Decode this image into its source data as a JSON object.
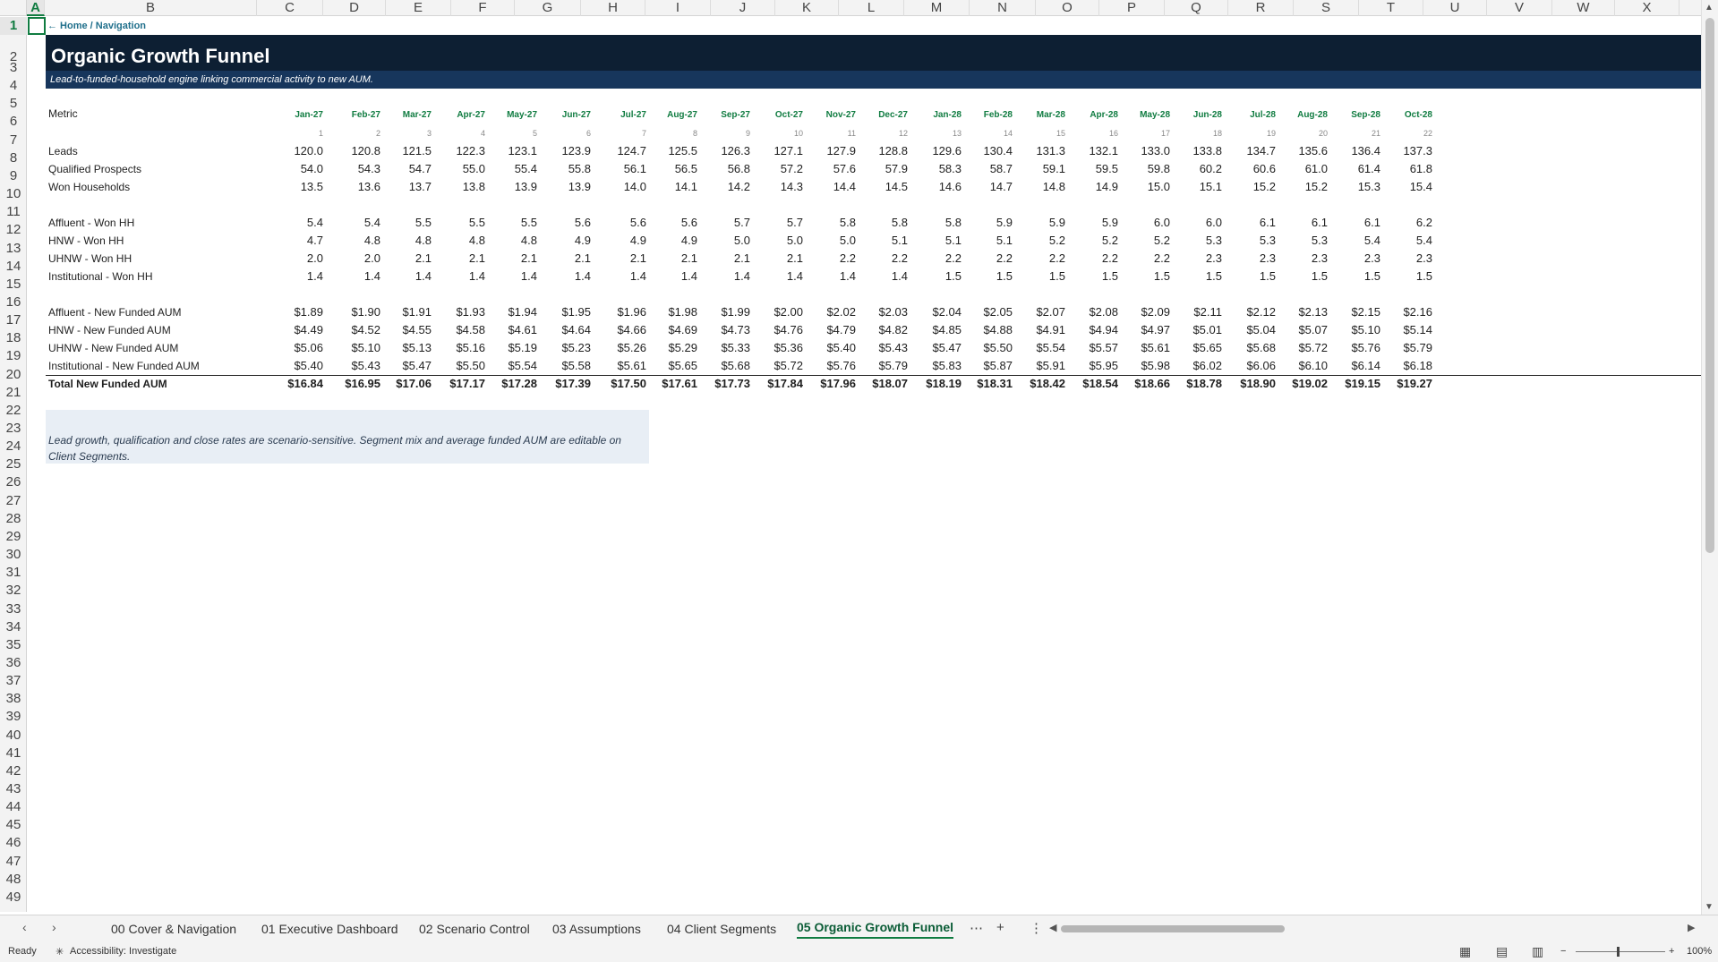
{
  "columns": [
    "A",
    "B",
    "C",
    "D",
    "E",
    "F",
    "G",
    "H",
    "I",
    "J",
    "K",
    "L",
    "M",
    "N",
    "O",
    "P",
    "Q",
    "R",
    "S",
    "T",
    "U",
    "V",
    "W",
    "X"
  ],
  "rows": [
    "1",
    "2",
    "3",
    "4",
    "5",
    "6",
    "7",
    "8",
    "9",
    "10",
    "11",
    "12",
    "13",
    "14",
    "15",
    "16",
    "17",
    "18",
    "19",
    "20",
    "21",
    "22",
    "23",
    "24",
    "25",
    "26",
    "27",
    "28",
    "29",
    "30",
    "31",
    "32",
    "33",
    "34",
    "35",
    "36",
    "37",
    "38",
    "39",
    "40",
    "41",
    "42",
    "43",
    "44",
    "45",
    "46",
    "47",
    "48",
    "49"
  ],
  "nav_link": "← Home / Navigation",
  "title": "Organic Growth Funnel",
  "subtitle": "Lead-to-funded-household engine linking commercial activity to new AUM.",
  "metric_header": "Metric",
  "months": [
    "Jan-27",
    "Feb-27",
    "Mar-27",
    "Apr-27",
    "May-27",
    "Jun-27",
    "Jul-27",
    "Aug-27",
    "Sep-27",
    "Oct-27",
    "Nov-27",
    "Dec-27",
    "Jan-28",
    "Feb-28",
    "Mar-28",
    "Apr-28",
    "May-28",
    "Jun-28",
    "Jul-28",
    "Aug-28",
    "Sep-28",
    "Oct-28"
  ],
  "period_index": [
    "1",
    "2",
    "3",
    "4",
    "5",
    "6",
    "7",
    "8",
    "9",
    "10",
    "11",
    "12",
    "13",
    "14",
    "15",
    "16",
    "17",
    "18",
    "19",
    "20",
    "21",
    "22"
  ],
  "table_rows": [
    {
      "label": "Leads",
      "values": [
        "120.0",
        "120.8",
        "121.5",
        "122.3",
        "123.1",
        "123.9",
        "124.7",
        "125.5",
        "126.3",
        "127.1",
        "127.9",
        "128.8",
        "129.6",
        "130.4",
        "131.3",
        "132.1",
        "133.0",
        "133.8",
        "134.7",
        "135.6",
        "136.4",
        "137.3"
      ]
    },
    {
      "label": "Qualified Prospects",
      "values": [
        "54.0",
        "54.3",
        "54.7",
        "55.0",
        "55.4",
        "55.8",
        "56.1",
        "56.5",
        "56.8",
        "57.2",
        "57.6",
        "57.9",
        "58.3",
        "58.7",
        "59.1",
        "59.5",
        "59.8",
        "60.2",
        "60.6",
        "61.0",
        "61.4",
        "61.8"
      ]
    },
    {
      "label": "Won Households",
      "values": [
        "13.5",
        "13.6",
        "13.7",
        "13.8",
        "13.9",
        "13.9",
        "14.0",
        "14.1",
        "14.2",
        "14.3",
        "14.4",
        "14.5",
        "14.6",
        "14.7",
        "14.8",
        "14.9",
        "15.0",
        "15.1",
        "15.2",
        "15.2",
        "15.3",
        "15.4"
      ]
    },
    {
      "label": "Affluent - Won HH",
      "values": [
        "5.4",
        "5.4",
        "5.5",
        "5.5",
        "5.5",
        "5.6",
        "5.6",
        "5.6",
        "5.7",
        "5.7",
        "5.8",
        "5.8",
        "5.8",
        "5.9",
        "5.9",
        "5.9",
        "6.0",
        "6.0",
        "6.1",
        "6.1",
        "6.1",
        "6.2"
      ]
    },
    {
      "label": "HNW - Won HH",
      "values": [
        "4.7",
        "4.8",
        "4.8",
        "4.8",
        "4.8",
        "4.9",
        "4.9",
        "4.9",
        "5.0",
        "5.0",
        "5.0",
        "5.1",
        "5.1",
        "5.1",
        "5.2",
        "5.2",
        "5.2",
        "5.3",
        "5.3",
        "5.3",
        "5.4",
        "5.4"
      ]
    },
    {
      "label": "UHNW - Won HH",
      "values": [
        "2.0",
        "2.0",
        "2.1",
        "2.1",
        "2.1",
        "2.1",
        "2.1",
        "2.1",
        "2.1",
        "2.1",
        "2.2",
        "2.2",
        "2.2",
        "2.2",
        "2.2",
        "2.2",
        "2.2",
        "2.3",
        "2.3",
        "2.3",
        "2.3",
        "2.3"
      ]
    },
    {
      "label": "Institutional - Won HH",
      "values": [
        "1.4",
        "1.4",
        "1.4",
        "1.4",
        "1.4",
        "1.4",
        "1.4",
        "1.4",
        "1.4",
        "1.4",
        "1.4",
        "1.4",
        "1.5",
        "1.5",
        "1.5",
        "1.5",
        "1.5",
        "1.5",
        "1.5",
        "1.5",
        "1.5",
        "1.5"
      ]
    },
    {
      "label": "Affluent - New Funded AUM",
      "values": [
        "$1.89",
        "$1.90",
        "$1.91",
        "$1.93",
        "$1.94",
        "$1.95",
        "$1.96",
        "$1.98",
        "$1.99",
        "$2.00",
        "$2.02",
        "$2.03",
        "$2.04",
        "$2.05",
        "$2.07",
        "$2.08",
        "$2.09",
        "$2.11",
        "$2.12",
        "$2.13",
        "$2.15",
        "$2.16"
      ]
    },
    {
      "label": "HNW - New Funded AUM",
      "values": [
        "$4.49",
        "$4.52",
        "$4.55",
        "$4.58",
        "$4.61",
        "$4.64",
        "$4.66",
        "$4.69",
        "$4.73",
        "$4.76",
        "$4.79",
        "$4.82",
        "$4.85",
        "$4.88",
        "$4.91",
        "$4.94",
        "$4.97",
        "$5.01",
        "$5.04",
        "$5.07",
        "$5.10",
        "$5.14"
      ]
    },
    {
      "label": "UHNW - New Funded AUM",
      "values": [
        "$5.06",
        "$5.10",
        "$5.13",
        "$5.16",
        "$5.19",
        "$5.23",
        "$5.26",
        "$5.29",
        "$5.33",
        "$5.36",
        "$5.40",
        "$5.43",
        "$5.47",
        "$5.50",
        "$5.54",
        "$5.57",
        "$5.61",
        "$5.65",
        "$5.68",
        "$5.72",
        "$5.76",
        "$5.79"
      ]
    },
    {
      "label": "Institutional - New Funded AUM",
      "values": [
        "$5.40",
        "$5.43",
        "$5.47",
        "$5.50",
        "$5.54",
        "$5.58",
        "$5.61",
        "$5.65",
        "$5.68",
        "$5.72",
        "$5.76",
        "$5.79",
        "$5.83",
        "$5.87",
        "$5.91",
        "$5.95",
        "$5.98",
        "$6.02",
        "$6.06",
        "$6.10",
        "$6.14",
        "$6.18"
      ]
    },
    {
      "label": "Total New Funded AUM",
      "values": [
        "$16.84",
        "$16.95",
        "$17.06",
        "$17.17",
        "$17.28",
        "$17.39",
        "$17.50",
        "$17.61",
        "$17.73",
        "$17.84",
        "$17.96",
        "$18.07",
        "$18.19",
        "$18.31",
        "$18.42",
        "$18.54",
        "$18.66",
        "$18.78",
        "$18.90",
        "$19.02",
        "$19.15",
        "$19.27"
      ]
    }
  ],
  "note": "Lead growth, qualification and close rates are scenario-sensitive. Segment mix and average funded AUM are editable on Client Segments.",
  "sheet_tabs": [
    "00 Cover & Navigation",
    "01 Executive Dashboard",
    "02 Scenario Control",
    "03 Assumptions",
    "04 Client Segments",
    "05 Organic Growth Funnel"
  ],
  "active_tab": "05 Organic Growth Funnel",
  "status": {
    "ready": "Ready",
    "accessibility": "Accessibility: Investigate",
    "zoom": "100%"
  },
  "accent_color": "#107c41",
  "banner_color": "#0d1f33"
}
